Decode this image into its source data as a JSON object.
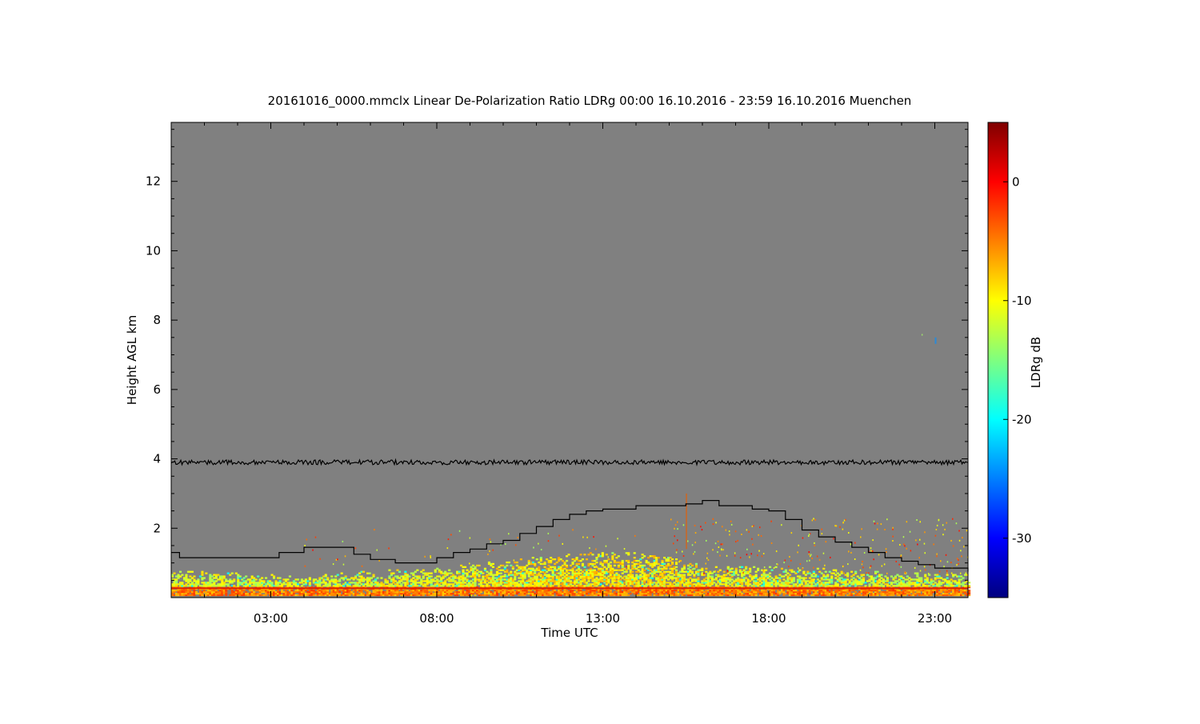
{
  "chart_data": {
    "type": "heatmap",
    "title": "20161016_0000.mmclx Linear De-Polarization Ratio LDRg   00:00 16.10.2016 - 23:59 16.10.2016 Muenchen",
    "xlabel": "Time UTC",
    "ylabel": "Height AGL km",
    "colorbar_label": "LDRg dB",
    "xlim": [
      0.0,
      24.0
    ],
    "ylim": [
      0.0,
      13.7
    ],
    "x_ticks": [
      {
        "value": 3,
        "label": "03:00"
      },
      {
        "value": 8,
        "label": "08:00"
      },
      {
        "value": 13,
        "label": "13:00"
      },
      {
        "value": 18,
        "label": "18:00"
      },
      {
        "value": 23,
        "label": "23:00"
      }
    ],
    "y_ticks": [
      {
        "value": 2,
        "label": "2"
      },
      {
        "value": 4,
        "label": "4"
      },
      {
        "value": 6,
        "label": "6"
      },
      {
        "value": 8,
        "label": "8"
      },
      {
        "value": 10,
        "label": "10"
      },
      {
        "value": 12,
        "label": "12"
      }
    ],
    "colorbar_range": [
      -35,
      5
    ],
    "colorbar_ticks": [
      {
        "value": 0,
        "label": "0"
      },
      {
        "value": -10,
        "label": "-10"
      },
      {
        "value": -20,
        "label": "-20"
      },
      {
        "value": -30,
        "label": "-30"
      }
    ],
    "colormap": [
      "#00007f",
      "#0000ff",
      "#007fff",
      "#00ffff",
      "#7fff7f",
      "#ffff00",
      "#ff7f00",
      "#ff0000",
      "#7f0000"
    ],
    "background_color": "#808080",
    "noise_line_height_km": 3.9,
    "series": [
      {
        "type": "step",
        "x": [
          0.0,
          0.25,
          1.5,
          2.5,
          3.25,
          4.0,
          4.75,
          5.5,
          6.0,
          6.75,
          7.25,
          8.0,
          8.5,
          9.0,
          9.5,
          10.0,
          10.5,
          11.0,
          11.5,
          12.0,
          12.5,
          13.0,
          13.5,
          14.0,
          14.5,
          15.0,
          15.5,
          16.0,
          16.5,
          17.0,
          17.5,
          18.0,
          18.5,
          19.0,
          19.5,
          20.0,
          20.5,
          21.0,
          21.5,
          22.0,
          22.5,
          23.0,
          23.5,
          24.0
        ],
        "y": [
          1.3,
          1.15,
          1.15,
          1.15,
          1.3,
          1.45,
          1.45,
          1.25,
          1.1,
          1.0,
          1.0,
          1.15,
          1.3,
          1.4,
          1.55,
          1.65,
          1.85,
          2.05,
          2.25,
          2.4,
          2.5,
          2.55,
          2.55,
          2.65,
          2.65,
          2.65,
          2.7,
          2.8,
          2.65,
          2.65,
          2.55,
          2.5,
          2.25,
          1.95,
          1.75,
          1.6,
          1.45,
          1.3,
          1.15,
          1.05,
          0.95,
          0.85,
          0.85,
          0.75
        ]
      }
    ],
    "echo_top_km": [
      [
        0.0,
        0.75
      ],
      [
        2.0,
        0.7
      ],
      [
        4.0,
        0.6
      ],
      [
        6.0,
        0.75
      ],
      [
        8.0,
        0.85
      ],
      [
        10.0,
        1.05
      ],
      [
        12.0,
        1.25
      ],
      [
        13.5,
        1.3
      ],
      [
        15.0,
        1.2
      ],
      [
        16.0,
        0.9
      ],
      [
        18.0,
        0.9
      ],
      [
        20.0,
        0.8
      ],
      [
        22.0,
        0.7
      ],
      [
        24.0,
        0.65
      ]
    ]
  }
}
